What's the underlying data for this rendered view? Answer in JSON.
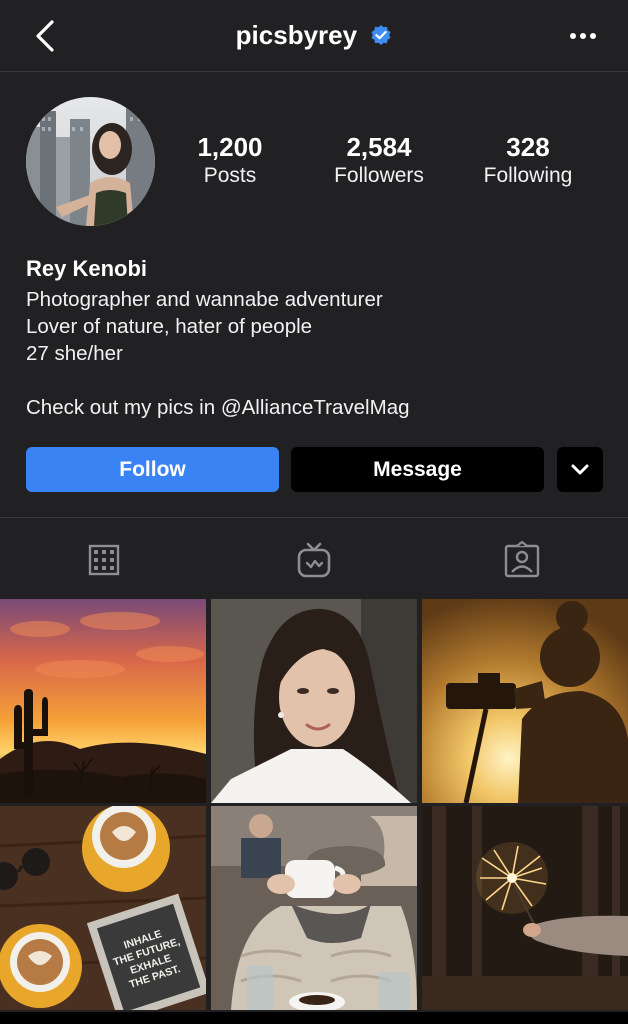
{
  "header": {
    "username": "picsbyrey",
    "back_icon": "chevron-left-icon",
    "verified_icon": "verified-badge-icon",
    "more_icon": "more-horizontal-icon"
  },
  "profile": {
    "stats": [
      {
        "value": "1,200",
        "label": "Posts"
      },
      {
        "value": "2,584",
        "label": "Followers"
      },
      {
        "value": "328",
        "label": "Following"
      }
    ],
    "name": "Rey Kenobi",
    "bio": [
      "Photographer and wannabe adventurer",
      "Lover of nature, hater of people",
      "27 she/her",
      "",
      "Check out my pics in @AllianceTravelMag"
    ]
  },
  "actions": {
    "follow_label": "Follow",
    "message_label": "Message",
    "more_icon": "chevron-down-icon"
  },
  "tabs": [
    {
      "icon": "grid-icon"
    },
    {
      "icon": "igtv-icon"
    },
    {
      "icon": "tagged-icon"
    }
  ],
  "posts": [
    {
      "subject": "desert-sunset-cactus"
    },
    {
      "subject": "woman-portrait"
    },
    {
      "subject": "photographer-silhouette"
    },
    {
      "subject": "latte-coffee-table",
      "sign_text": [
        "INHALE",
        "THE FUTURE,",
        "EXHALE",
        "THE PAST."
      ]
    },
    {
      "subject": "woman-cafe-mug"
    },
    {
      "subject": "sparkler-forest"
    }
  ],
  "colors": {
    "background": "#212124",
    "accent": "#3a83f5",
    "verified": "#3d8ef0",
    "divider": "#3a3a3d"
  }
}
